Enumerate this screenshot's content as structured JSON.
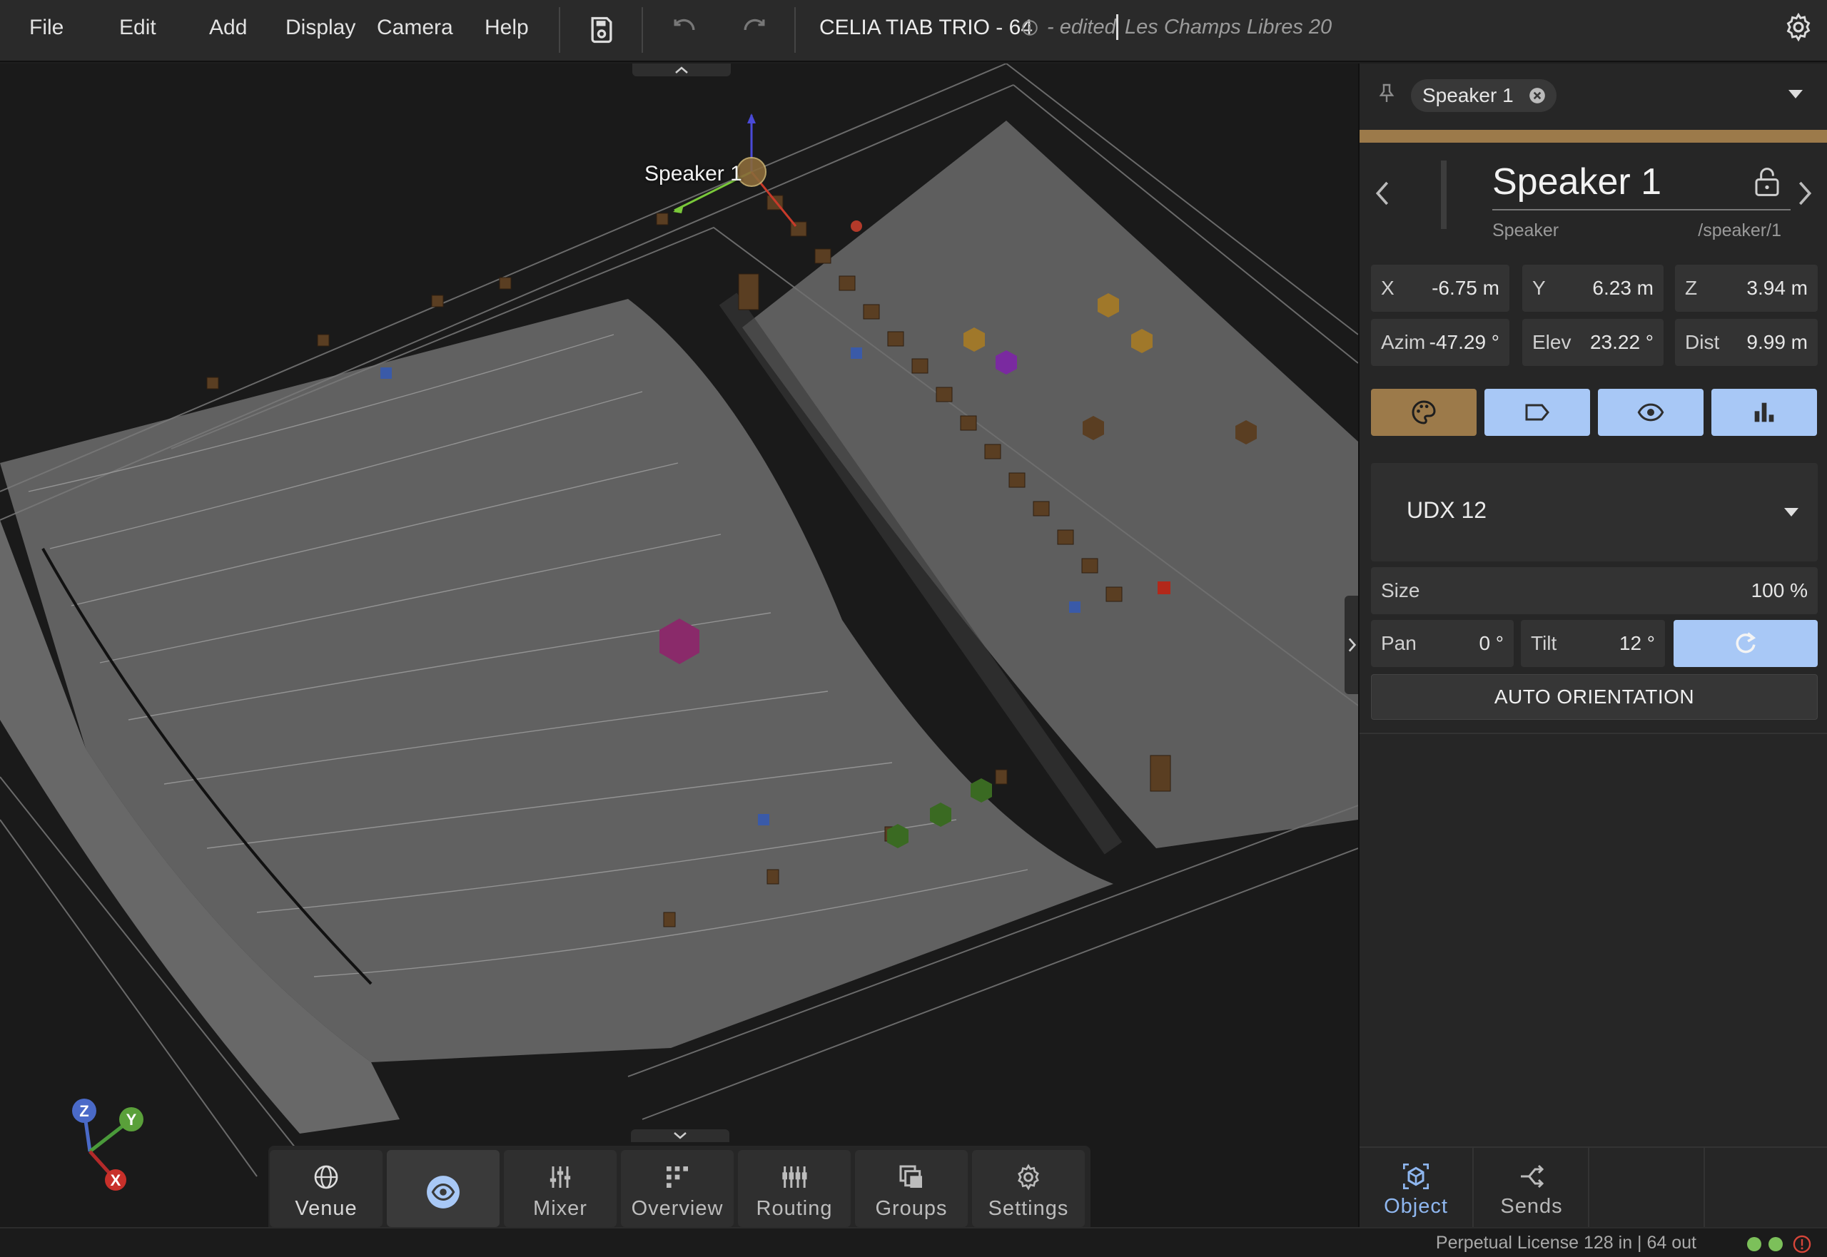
{
  "menubar": {
    "menus": [
      "File",
      "Edit",
      "Add",
      "Display",
      "Camera",
      "Help"
    ],
    "document_title": "CELIA TIAB TRIO - 64",
    "edited_label": "- edited",
    "venue_name": "Les Champs Libres 20"
  },
  "viewport": {
    "selected_object_label": "Speaker 1",
    "axes": {
      "x": "X",
      "y": "Y",
      "z": "Z"
    }
  },
  "bottom_bar": {
    "items": [
      "Venue",
      "",
      "Mixer",
      "Overview",
      "Routing",
      "Groups",
      "Settings"
    ]
  },
  "panel": {
    "chip_label": "Speaker 1",
    "accent_color": "#9c7a4a",
    "object_name": "Speaker 1",
    "object_type": "Speaker",
    "object_path": "/speaker/1",
    "position": {
      "x": {
        "label": "X",
        "value": "-6.75 m"
      },
      "y": {
        "label": "Y",
        "value": "6.23 m"
      },
      "z": {
        "label": "Z",
        "value": "3.94 m"
      },
      "azim": {
        "label": "Azim",
        "value": "-47.29 °"
      },
      "elev": {
        "label": "Elev",
        "value": "23.22 °"
      },
      "dist": {
        "label": "Dist",
        "value": "9.99 m"
      }
    },
    "mode_buttons": [
      "palette-icon",
      "tag-icon",
      "eye-icon",
      "bar-chart-icon"
    ],
    "model": "UDX 12",
    "size": {
      "label": "Size",
      "value": "100 %"
    },
    "pan": {
      "label": "Pan",
      "value": "0 °"
    },
    "tilt": {
      "label": "Tilt",
      "value": "12 °"
    },
    "auto_orientation_label": "AUTO ORIENTATION",
    "tabs": [
      "Object",
      "Sends"
    ]
  },
  "status": {
    "license": "Perpetual License 128 in | 64 out"
  }
}
